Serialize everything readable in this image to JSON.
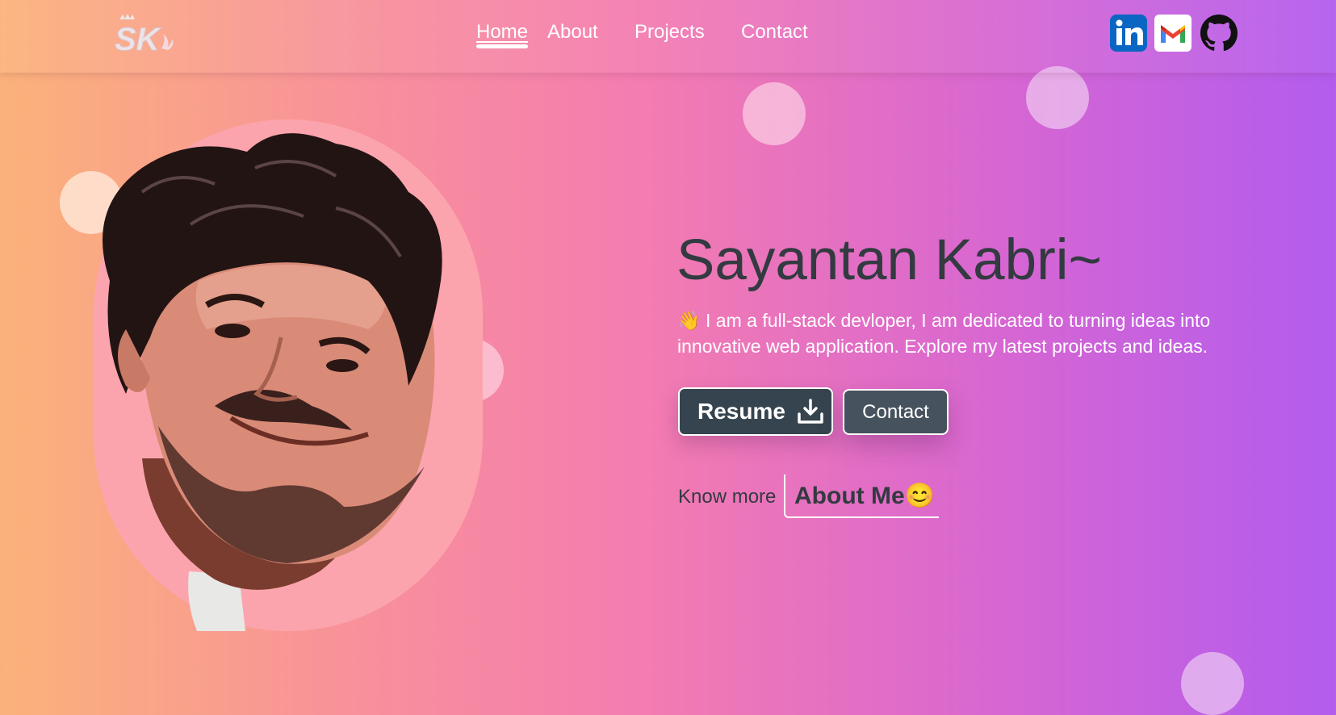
{
  "nav": {
    "logo_text": "SK",
    "links": [
      {
        "label": "Home",
        "active": true
      },
      {
        "label": "About",
        "active": false
      },
      {
        "label": "Projects",
        "active": false
      },
      {
        "label": "Contact",
        "active": false
      }
    ],
    "social_icons": [
      "linkedin-icon",
      "gmail-icon",
      "github-icon"
    ]
  },
  "hero": {
    "name": "Sayantan Kabri~",
    "description": "👋 I am a full-stack devloper, I am dedicated to turning ideas into innovative web application. Explore my latest projects and ideas.",
    "resume_button": "Resume",
    "resume_icon": "download-icon",
    "contact_button": "Contact",
    "know_more_label": "Know more",
    "about_me_link": "About Me😊"
  },
  "colors": {
    "gradient_start": "#fbb27a",
    "gradient_mid": "#f47cb0",
    "gradient_end": "#b25cee",
    "text_dark": "#333a40",
    "button_bg": "#36444f",
    "portrait_bg": "#fca4ad"
  }
}
